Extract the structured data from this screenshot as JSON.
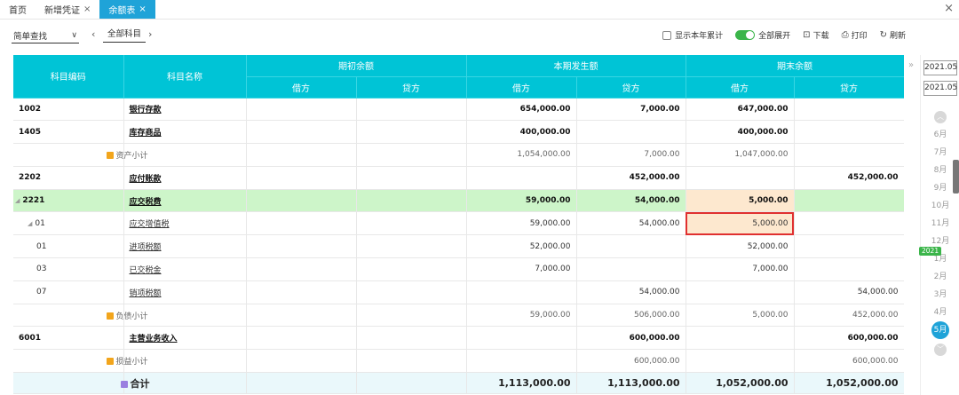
{
  "tabs": [
    {
      "label": "首页",
      "closable": false,
      "active": false
    },
    {
      "label": "新增凭证",
      "closable": true,
      "active": false
    },
    {
      "label": "余额表",
      "closable": true,
      "active": true
    }
  ],
  "toolbar": {
    "search_mode": "简单查找",
    "crumb": "全部科目",
    "show_year_total": "显示本年累计",
    "expand_all": "全部展开",
    "download": "下载",
    "print": "打印",
    "refresh": "刷新"
  },
  "table": {
    "headers": {
      "code": "科目编码",
      "name": "科目名称",
      "opening": "期初余额",
      "period": "本期发生额",
      "closing": "期末余额",
      "debit": "借方",
      "credit": "贷方"
    },
    "rows": [
      {
        "type": "bold",
        "code": "1002",
        "name": "银行存款",
        "od": "",
        "oc": "",
        "pd": "654,000.00",
        "pc": "7,000.00",
        "cd": "647,000.00",
        "cc": ""
      },
      {
        "type": "bold",
        "code": "1405",
        "name": "库存商品",
        "od": "",
        "oc": "",
        "pd": "400,000.00",
        "pc": "",
        "cd": "400,000.00",
        "cc": ""
      },
      {
        "type": "sub",
        "code": "",
        "name": "资产小计",
        "od": "",
        "oc": "",
        "pd": "1,054,000.00",
        "pc": "7,000.00",
        "cd": "1,047,000.00",
        "cc": ""
      },
      {
        "type": "bold",
        "code": "2202",
        "name": "应付账款",
        "od": "",
        "oc": "",
        "pd": "",
        "pc": "452,000.00",
        "cd": "",
        "cc": "452,000.00"
      },
      {
        "type": "bold green",
        "code": "2221",
        "name": "应交税费",
        "od": "",
        "oc": "",
        "pd": "59,000.00",
        "pc": "54,000.00",
        "cd": "5,000.00",
        "cc": ""
      },
      {
        "type": "child",
        "code": "01",
        "name": "应交增值税",
        "od": "",
        "oc": "",
        "pd": "59,000.00",
        "pc": "54,000.00",
        "cd": "5,000.00",
        "cc": ""
      },
      {
        "type": "child2",
        "code": "01",
        "name": "进项税额",
        "od": "",
        "oc": "",
        "pd": "52,000.00",
        "pc": "",
        "cd": "52,000.00",
        "cc": ""
      },
      {
        "type": "child2",
        "code": "03",
        "name": "已交税金",
        "od": "",
        "oc": "",
        "pd": "7,000.00",
        "pc": "",
        "cd": "7,000.00",
        "cc": ""
      },
      {
        "type": "child2",
        "code": "07",
        "name": "销项税额",
        "od": "",
        "oc": "",
        "pd": "",
        "pc": "54,000.00",
        "cd": "",
        "cc": "54,000.00"
      },
      {
        "type": "sub",
        "code": "",
        "name": "负债小计",
        "od": "",
        "oc": "",
        "pd": "59,000.00",
        "pc": "506,000.00",
        "cd": "5,000.00",
        "cc": "452,000.00"
      },
      {
        "type": "bold",
        "code": "6001",
        "name": "主营业务收入",
        "od": "",
        "oc": "",
        "pd": "",
        "pc": "600,000.00",
        "cd": "",
        "cc": "600,000.00"
      },
      {
        "type": "sub",
        "code": "",
        "name": "损益小计",
        "od": "",
        "oc": "",
        "pd": "",
        "pc": "600,000.00",
        "cd": "",
        "cc": "600,000.00"
      },
      {
        "type": "total",
        "code": "",
        "name": "合计",
        "od": "",
        "oc": "",
        "pd": "1,113,000.00",
        "pc": "1,113,000.00",
        "cd": "1,052,000.00",
        "cc": "1,052,000.00"
      }
    ]
  },
  "side": {
    "date_from": "2021.05",
    "date_to": "2021.05",
    "months_before": [
      "6月",
      "7月",
      "8月",
      "9月",
      "10月",
      "11月",
      "12月"
    ],
    "year_badge": "2021",
    "months_after": [
      "1月",
      "2月",
      "3月",
      "4月"
    ],
    "active_month": "5月"
  },
  "colors": {
    "accent": "#1fa3d8",
    "header": "#00c4d6",
    "highlight_row": "#cdf5c9",
    "highlight_cell": "#fde8cf",
    "box": "#e03030"
  }
}
